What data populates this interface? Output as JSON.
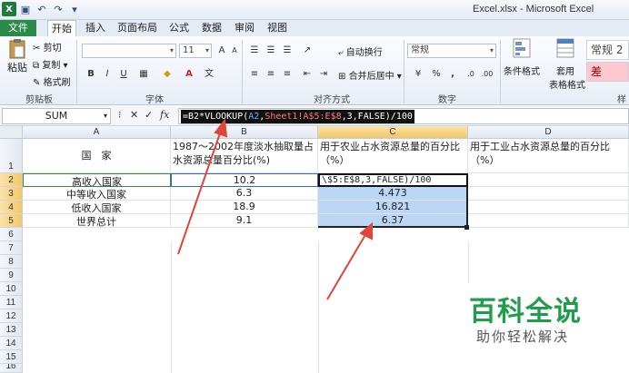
{
  "window": {
    "title": "Excel.xlsx - Microsoft Excel"
  },
  "qat": {
    "undo_icon": "undo-icon",
    "redo_icon": "redo-icon",
    "save_icon": "save-icon"
  },
  "tabs": [
    {
      "label": "文件"
    },
    {
      "label": "开始"
    },
    {
      "label": "插入"
    },
    {
      "label": "页面布局"
    },
    {
      "label": "公式"
    },
    {
      "label": "数据"
    },
    {
      "label": "审阅"
    },
    {
      "label": "视图"
    }
  ],
  "ribbon": {
    "clipboard": {
      "paste": "粘贴",
      "cut": "剪切",
      "copy": "复制",
      "format_painter": "格式刷",
      "group": "剪贴板"
    },
    "font": {
      "size": "11",
      "group": "字体"
    },
    "alignment": {
      "wrap": "自动换行",
      "merge": "合并后居中",
      "group": "对齐方式"
    },
    "number": {
      "format": "常规",
      "percent": "%",
      "comma": ",",
      "group": "数字"
    },
    "styles": {
      "conditional": "条件格式",
      "table_line1": "套用",
      "table_line2": "表格格式",
      "style_box": "常规 2",
      "style_box2": "差",
      "group_partial": "样"
    }
  },
  "formula_bar": {
    "name_box": "SUM",
    "formula_prefix": "=B2*VLOOKUP(",
    "ref_a2": "A2",
    "formula_mid": ",",
    "ref_sheet": "Sheet1!A$5:E$8",
    "formula_suffix": ",3,FALSE)/100"
  },
  "grid": {
    "columns": [
      "A",
      "B",
      "C",
      "D"
    ],
    "rows": [
      "1",
      "2",
      "3",
      "4",
      "5",
      "6",
      "7",
      "8",
      "9",
      "10",
      "11",
      "12",
      "13",
      "14",
      "15",
      "16"
    ],
    "header": {
      "a": "国　家",
      "b": "1987～2002年度淡水抽取量占水资源总量百分比(%)",
      "c": "用于农业占水资源总量的百分比（%）",
      "d": "用于工业占水资源总量的百分比（%）"
    },
    "data": [
      {
        "a": "高收入国家",
        "b": "10.2",
        "c": "\\$5:E$8,3,FALSE)/100"
      },
      {
        "a": "中等收入国家",
        "b": "6.3",
        "c": "4.473"
      },
      {
        "a": "低收入国家",
        "b": "18.9",
        "c": "16.821"
      },
      {
        "a": "世界总计",
        "b": "9.1",
        "c": "6.37"
      }
    ]
  },
  "watermark": {
    "logo": "百科全说",
    "sub": "助你轻松解决"
  },
  "colors": {
    "file_tab": "#2a8a4a",
    "selection": "#bcd6f5",
    "arrow": "#e0453a",
    "watermark": "#1f9d4c"
  }
}
